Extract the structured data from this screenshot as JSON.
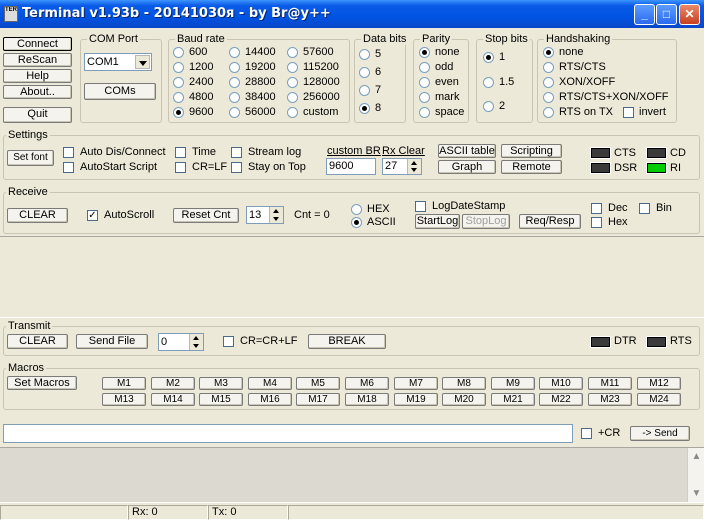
{
  "title": "Terminal v1.93b - 20141030я - by Br@y++",
  "appicon_text": "TERM",
  "window": {
    "minimize": "_",
    "maximize": "□",
    "close": "✕"
  },
  "conn": {
    "connect": "Connect",
    "rescan": "ReScan",
    "help": "Help",
    "about": "About..",
    "quit": "Quit"
  },
  "comport": {
    "legend": "COM Port",
    "value": "COM1",
    "coms": "COMs"
  },
  "baud": {
    "legend": "Baud rate",
    "options": [
      "600",
      "1200",
      "2400",
      "4800",
      "9600",
      "14400",
      "19200",
      "28800",
      "38400",
      "56000",
      "57600",
      "115200",
      "128000",
      "256000",
      "custom"
    ],
    "selected": "9600"
  },
  "databits": {
    "legend": "Data bits",
    "options": [
      "5",
      "6",
      "7",
      "8"
    ],
    "selected": "8"
  },
  "parity": {
    "legend": "Parity",
    "options": [
      "none",
      "odd",
      "even",
      "mark",
      "space"
    ],
    "selected": "none"
  },
  "stopbits": {
    "legend": "Stop bits",
    "options": [
      "1",
      "1.5",
      "2"
    ],
    "selected": "1"
  },
  "handshaking": {
    "legend": "Handshaking",
    "options": [
      "none",
      "RTS/CTS",
      "XON/XOFF",
      "RTS/CTS+XON/XOFF",
      "RTS on TX"
    ],
    "selected": "none",
    "invert": "invert"
  },
  "settings": {
    "legend": "Settings",
    "setfont": "Set font",
    "auto_dis": "Auto Dis/Connect",
    "autostart": "AutoStart Script",
    "time": "Time",
    "crlf": "CR=LF",
    "stream_log": "Stream log",
    "stay_on_top": "Stay on Top",
    "custom_br_label": "custom BR",
    "custom_br_value": "9600",
    "rx_clear_label": "Rx Clear",
    "rx_clear_value": "27",
    "ascii_table": "ASCII table",
    "graph": "Graph",
    "scripting": "Scripting",
    "remote": "Remote",
    "cts": "CTS",
    "cd": "CD",
    "dsr": "DSR",
    "ri": "RI"
  },
  "receive": {
    "legend": "Receive",
    "clear": "CLEAR",
    "autoscroll": "AutoScroll",
    "reset_cnt": "Reset Cnt",
    "cnt_value": "13",
    "cnt_label": "Cnt = 0",
    "hex": "HEX",
    "ascii": "ASCII",
    "logdatestamp": "LogDateStamp",
    "startlog": "StartLog",
    "stoplog": "StopLog",
    "reqresp": "Req/Resp",
    "dec": "Dec",
    "hexbox": "Hex",
    "bin": "Bin"
  },
  "transmit": {
    "legend": "Transmit",
    "clear": "CLEAR",
    "send_file": "Send File",
    "spin_value": "0",
    "crcrlf": "CR=CR+LF",
    "break": "BREAK",
    "dtr": "DTR",
    "rts": "RTS"
  },
  "macros": {
    "legend": "Macros",
    "set_macros": "Set Macros",
    "row1": [
      "M1",
      "M2",
      "M3",
      "M4",
      "M5",
      "M6",
      "M7",
      "M8",
      "M9",
      "M10",
      "M11",
      "M12"
    ],
    "row2": [
      "M13",
      "M14",
      "M15",
      "M16",
      "M17",
      "M18",
      "M19",
      "M20",
      "M21",
      "M22",
      "M23",
      "M24"
    ]
  },
  "send": {
    "input_value": "",
    "plus_cr": "+CR",
    "send": "-> Send"
  },
  "statusbar": {
    "rx": "Rx: 0",
    "tx": "Tx: 0"
  },
  "colors": {
    "title_blue": "#0054e3",
    "led_on": "#00cc00",
    "led_off": "#3a3a3a",
    "face": "#ece9d8"
  }
}
